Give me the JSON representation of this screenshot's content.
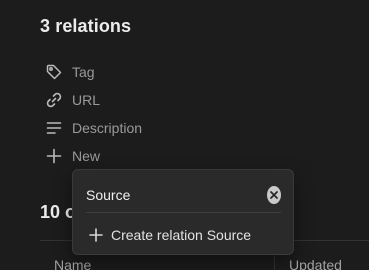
{
  "relations_section": {
    "title": "3 relations",
    "items": [
      {
        "label": "Tag",
        "icon": "tag-icon"
      },
      {
        "label": "URL",
        "icon": "link-icon"
      },
      {
        "label": "Description",
        "icon": "lines-icon"
      }
    ],
    "new_label": "New"
  },
  "objects_section": {
    "title": "10 o",
    "columns": [
      "Name",
      "Updated"
    ]
  },
  "popover": {
    "search_value": "Source",
    "clear_icon": "clear-icon",
    "create_label": "Create relation Source"
  }
}
